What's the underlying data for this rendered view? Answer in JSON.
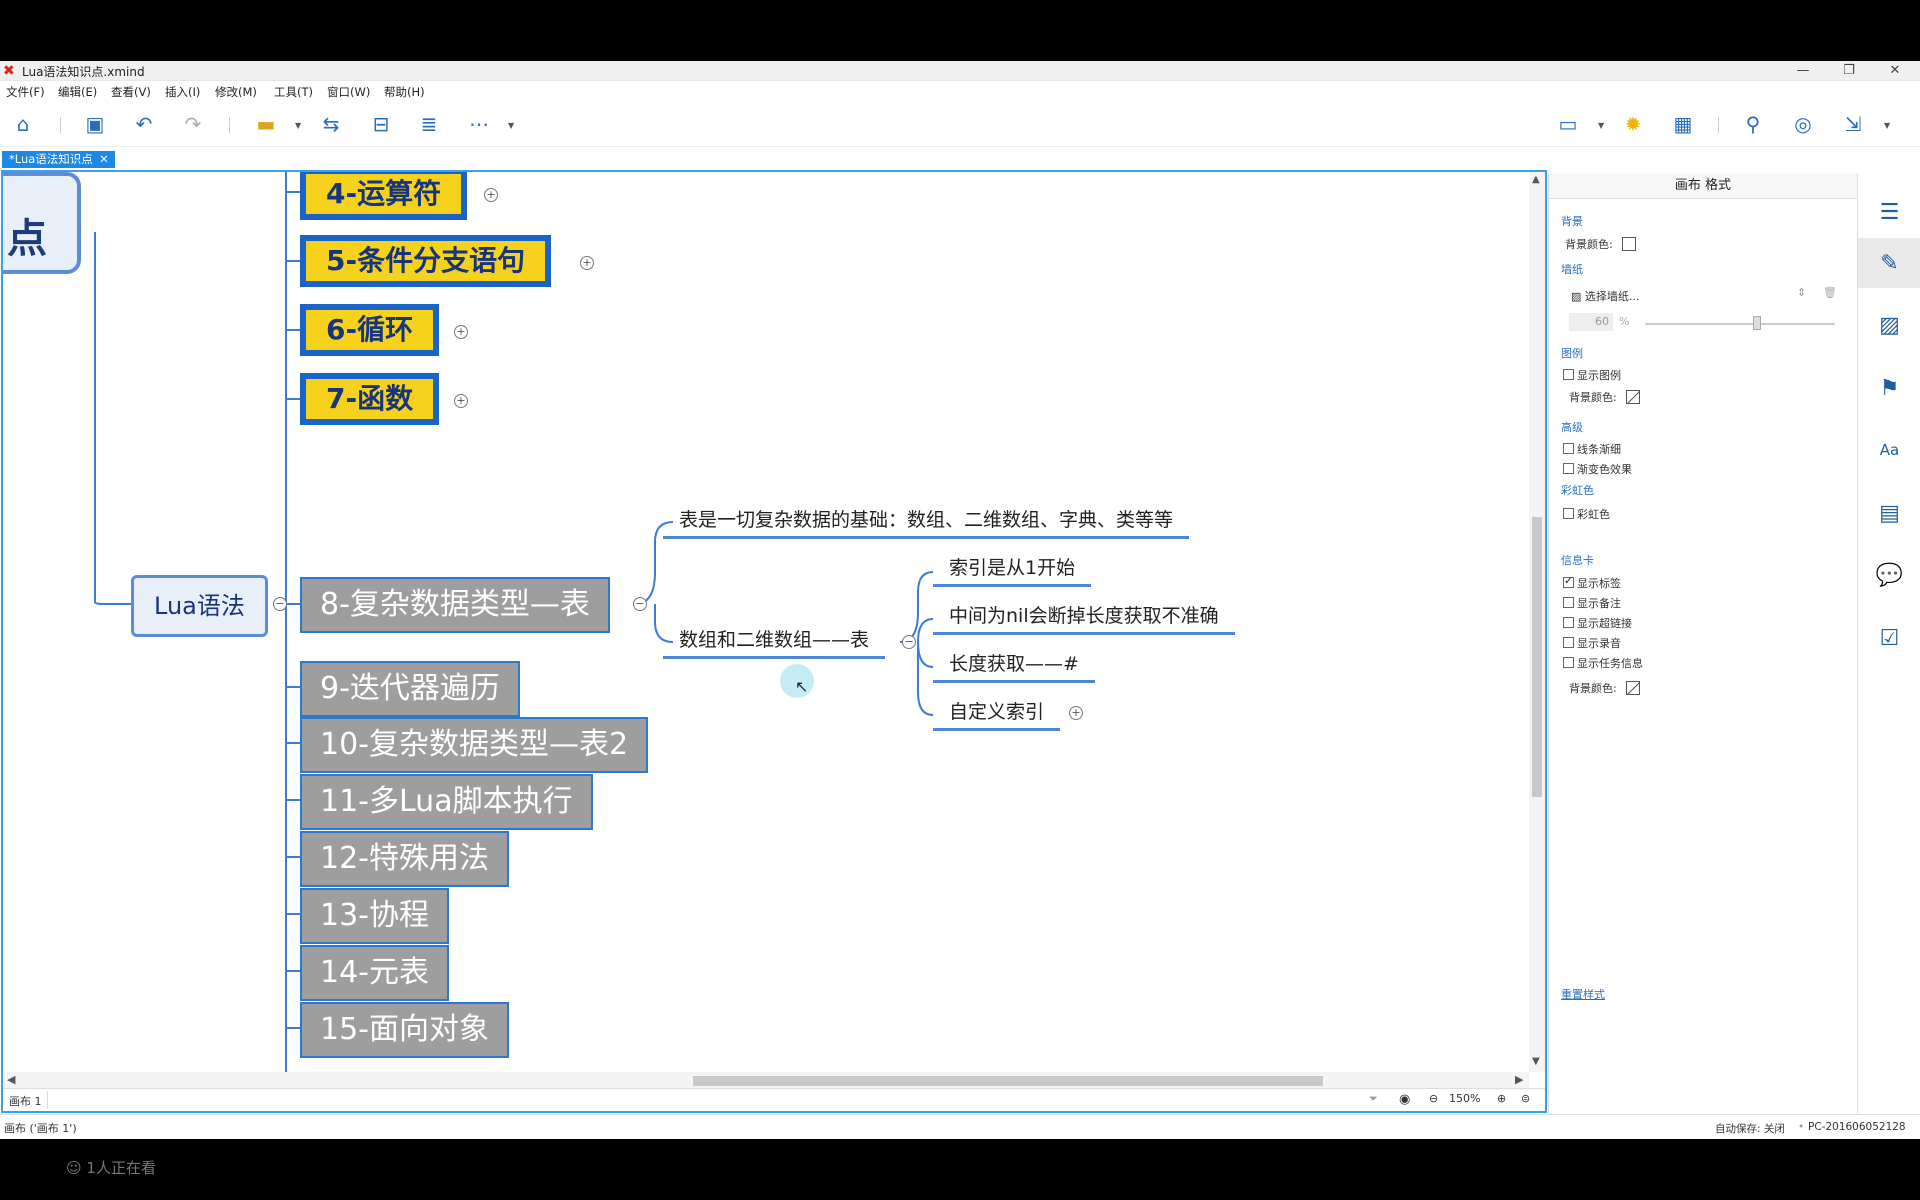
{
  "window": {
    "title": "Lua语法知识点.xmind"
  },
  "menu": [
    "文件(F)",
    "编辑(E)",
    "查看(V)",
    "插入(I)",
    "修改(M)",
    "工具(T)",
    "窗口(W)",
    "帮助(H)"
  ],
  "tab": {
    "label": "*Lua语法知识点",
    "close": "✕"
  },
  "mindmap": {
    "root_partial": "点",
    "central": "Lua语法",
    "yellow_topics": [
      "4-运算符",
      "5-条件分支语句",
      "6-循环",
      "7-函数"
    ],
    "selected_topic": "8-复杂数据类型—表",
    "sub_topics": [
      "表是一切复杂数据的基础：数组、二维数组、字典、类等等",
      "数组和二维数组——表"
    ],
    "array_children": [
      "索引是从1开始",
      "中间为nil会断掉长度获取不准确",
      "长度获取——#",
      "自定义索引"
    ],
    "gray_topics": [
      "9-迭代器遍历",
      "10-复杂数据类型—表2",
      "11-多Lua脚本执行",
      "12-特殊用法",
      "13-协程",
      "14-元表",
      "15-面向对象"
    ]
  },
  "sheet": {
    "name": "画布 1",
    "zoom": "150%"
  },
  "panel": {
    "header": "画布 格式",
    "background": {
      "section": "背景",
      "color_label": "背景颜色:"
    },
    "wallpaper": {
      "section": "墙纸",
      "select": "选择墙纸...",
      "opacity": "60",
      "unit": "%"
    },
    "legend": {
      "section": "图例",
      "show": "显示图例",
      "color_label": "背景颜色:"
    },
    "advanced": {
      "section": "高级",
      "taper": "线条渐细",
      "gradient": "渐变色效果"
    },
    "rainbow": {
      "section": "彩虹色",
      "option": "彩虹色"
    },
    "info_card": {
      "section": "信息卡",
      "options": [
        {
          "label": "显示标签",
          "checked": true
        },
        {
          "label": "显示备注",
          "checked": false
        },
        {
          "label": "显示超链接",
          "checked": false
        },
        {
          "label": "显示录音",
          "checked": false
        },
        {
          "label": "显示任务信息",
          "checked": false
        }
      ],
      "color_label": "背景颜色:"
    },
    "reset": "重置样式"
  },
  "status": {
    "left": "画布 ('画布 1')",
    "autosave": "自动保存: 关闭",
    "host": "PC-201606052128"
  },
  "viewer": "1人正在看",
  "colors": {
    "accent": "#1e88e5",
    "yellow_topic": "#f6d21d",
    "gray_topic": "#9e9e9e",
    "border_blue": "#1b64c7"
  }
}
